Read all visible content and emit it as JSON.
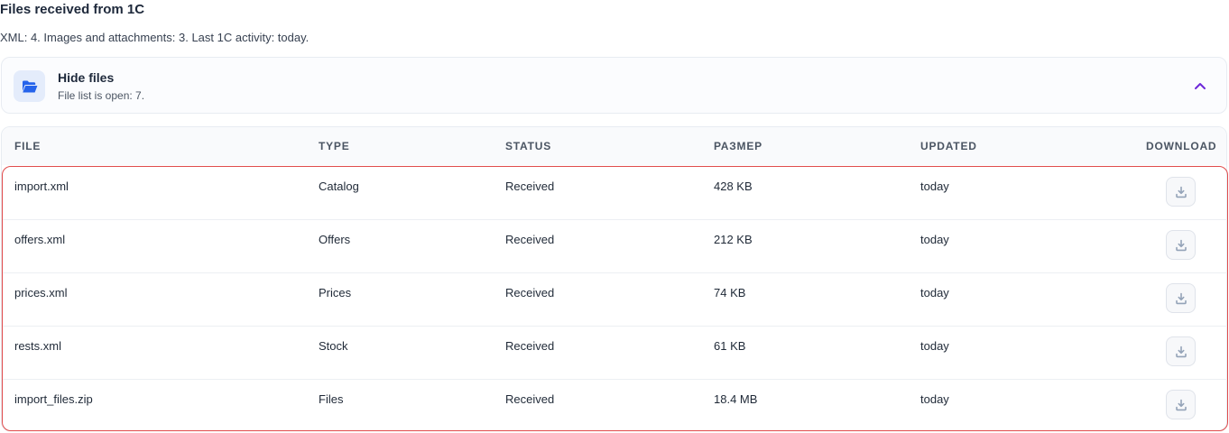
{
  "header": {
    "title": "Files received from 1C",
    "summary": "XML: 4. Images and attachments: 3. Last 1C activity: today."
  },
  "toggle": {
    "title": "Hide files",
    "subtitle": "File list is open: 7.",
    "icon": "folder-open-icon",
    "chevron": "chevron-up-icon"
  },
  "table": {
    "headers": {
      "file": "FILE",
      "type": "TYPE",
      "status": "STATUS",
      "size": "РАЗМЕР",
      "updated": "UPDATED",
      "download": "DOWNLOAD"
    },
    "rows": [
      {
        "file": "import.xml",
        "type": "Catalog",
        "status": "Received",
        "size": "428 KB",
        "updated": "today"
      },
      {
        "file": "offers.xml",
        "type": "Offers",
        "status": "Received",
        "size": "212 KB",
        "updated": "today"
      },
      {
        "file": "prices.xml",
        "type": "Prices",
        "status": "Received",
        "size": "74 KB",
        "updated": "today"
      },
      {
        "file": "rests.xml",
        "type": "Stock",
        "status": "Received",
        "size": "61 KB",
        "updated": "today"
      },
      {
        "file": "import_files.zip",
        "type": "Files",
        "status": "Received",
        "size": "18.4 MB",
        "updated": "today"
      }
    ]
  },
  "colors": {
    "accent": "#2563eb",
    "chevron": "#6d28d9",
    "highlight_border": "#e04b4b",
    "download_icon": "#94a3b8"
  }
}
